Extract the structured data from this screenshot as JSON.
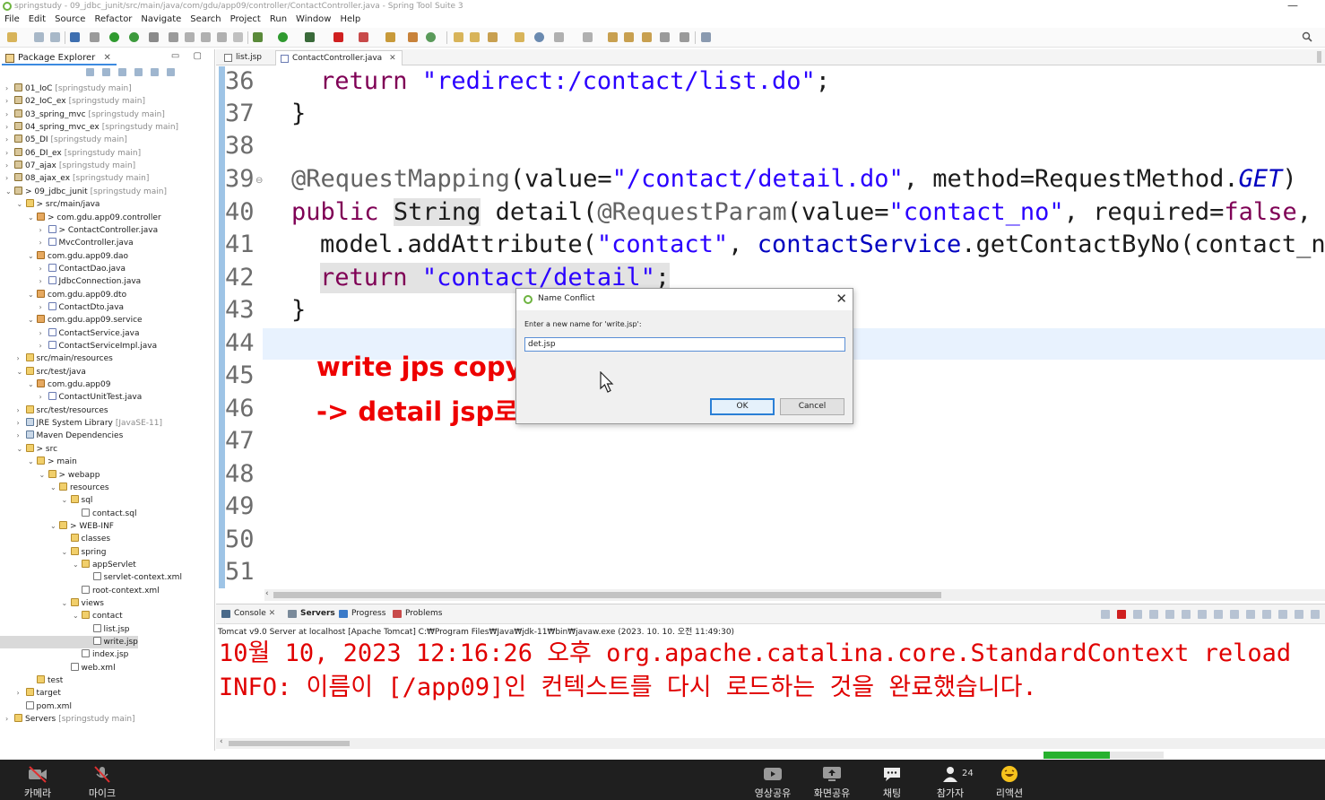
{
  "window": {
    "title": "springstudy - 09_jdbc_junit/src/main/java/com/gdu/app09/controller/ContactController.java - Spring Tool Suite 3"
  },
  "menu": [
    "File",
    "Edit",
    "Source",
    "Refactor",
    "Navigate",
    "Search",
    "Project",
    "Run",
    "Window",
    "Help"
  ],
  "package_explorer": {
    "title": "Package Explorer",
    "rows": [
      {
        "indent": 0,
        "twisty": ">",
        "icon": "proj",
        "label": "01_IoC",
        "suffix": "[springstudy main]"
      },
      {
        "indent": 0,
        "twisty": ">",
        "icon": "proj",
        "label": "02_IoC_ex",
        "suffix": "[springstudy main]"
      },
      {
        "indent": 0,
        "twisty": ">",
        "icon": "proj",
        "label": "03_spring_mvc",
        "suffix": "[springstudy main]"
      },
      {
        "indent": 0,
        "twisty": ">",
        "icon": "proj",
        "label": "04_spring_mvc_ex",
        "suffix": "[springstudy main]"
      },
      {
        "indent": 0,
        "twisty": ">",
        "icon": "proj",
        "label": "05_DI",
        "suffix": "[springstudy main]"
      },
      {
        "indent": 0,
        "twisty": ">",
        "icon": "proj",
        "label": "06_DI_ex",
        "suffix": "[springstudy main]"
      },
      {
        "indent": 0,
        "twisty": ">",
        "icon": "proj",
        "label": "07_ajax",
        "suffix": "[springstudy main]"
      },
      {
        "indent": 0,
        "twisty": ">",
        "icon": "proj",
        "label": "08_ajax_ex",
        "suffix": "[springstudy main]"
      },
      {
        "indent": 0,
        "twisty": "v",
        "icon": "proj",
        "label": "> 09_jdbc_junit",
        "suffix": "[springstudy main]"
      },
      {
        "indent": 1,
        "twisty": "v",
        "icon": "folder",
        "label": "> src/main/java",
        "suffix": ""
      },
      {
        "indent": 2,
        "twisty": "v",
        "icon": "pkgi",
        "label": "> com.gdu.app09.controller",
        "suffix": ""
      },
      {
        "indent": 3,
        "twisty": ">",
        "icon": "java",
        "label": "> ContactController.java",
        "suffix": ""
      },
      {
        "indent": 3,
        "twisty": ">",
        "icon": "java",
        "label": "MvcController.java",
        "suffix": ""
      },
      {
        "indent": 2,
        "twisty": "v",
        "icon": "pkgi",
        "label": "com.gdu.app09.dao",
        "suffix": ""
      },
      {
        "indent": 3,
        "twisty": ">",
        "icon": "java",
        "label": "ContactDao.java",
        "suffix": ""
      },
      {
        "indent": 3,
        "twisty": ">",
        "icon": "java",
        "label": "JdbcConnection.java",
        "suffix": ""
      },
      {
        "indent": 2,
        "twisty": "v",
        "icon": "pkgi",
        "label": "com.gdu.app09.dto",
        "suffix": ""
      },
      {
        "indent": 3,
        "twisty": ">",
        "icon": "java",
        "label": "ContactDto.java",
        "suffix": ""
      },
      {
        "indent": 2,
        "twisty": "v",
        "icon": "pkgi",
        "label": "com.gdu.app09.service",
        "suffix": ""
      },
      {
        "indent": 3,
        "twisty": ">",
        "icon": "java",
        "label": "ContactService.java",
        "suffix": ""
      },
      {
        "indent": 3,
        "twisty": ">",
        "icon": "java",
        "label": "ContactServiceImpl.java",
        "suffix": ""
      },
      {
        "indent": 1,
        "twisty": ">",
        "icon": "folder",
        "label": "src/main/resources",
        "suffix": ""
      },
      {
        "indent": 1,
        "twisty": "v",
        "icon": "folder",
        "label": "src/test/java",
        "suffix": ""
      },
      {
        "indent": 2,
        "twisty": "v",
        "icon": "pkgi",
        "label": "com.gdu.app09",
        "suffix": ""
      },
      {
        "indent": 3,
        "twisty": ">",
        "icon": "java",
        "label": "ContactUnitTest.java",
        "suffix": ""
      },
      {
        "indent": 1,
        "twisty": ">",
        "icon": "folder",
        "label": "src/test/resources",
        "suffix": ""
      },
      {
        "indent": 1,
        "twisty": ">",
        "icon": "lib",
        "label": "JRE System Library",
        "suffix": "[JavaSE-11]"
      },
      {
        "indent": 1,
        "twisty": ">",
        "icon": "lib",
        "label": "Maven Dependencies",
        "suffix": ""
      },
      {
        "indent": 1,
        "twisty": "v",
        "icon": "folder",
        "label": "> src",
        "suffix": ""
      },
      {
        "indent": 2,
        "twisty": "v",
        "icon": "folder",
        "label": "> main",
        "suffix": ""
      },
      {
        "indent": 3,
        "twisty": "v",
        "icon": "folder",
        "label": "> webapp",
        "suffix": ""
      },
      {
        "indent": 4,
        "twisty": "v",
        "icon": "folder",
        "label": "resources",
        "suffix": ""
      },
      {
        "indent": 5,
        "twisty": "v",
        "icon": "folder",
        "label": "sql",
        "suffix": ""
      },
      {
        "indent": 6,
        "twisty": "",
        "icon": "file",
        "label": "contact.sql",
        "suffix": ""
      },
      {
        "indent": 4,
        "twisty": "v",
        "icon": "folder",
        "label": "> WEB-INF",
        "suffix": ""
      },
      {
        "indent": 5,
        "twisty": "",
        "icon": "folder",
        "label": "classes",
        "suffix": ""
      },
      {
        "indent": 5,
        "twisty": "v",
        "icon": "folder",
        "label": "spring",
        "suffix": ""
      },
      {
        "indent": 6,
        "twisty": "v",
        "icon": "folder",
        "label": "appServlet",
        "suffix": ""
      },
      {
        "indent": 7,
        "twisty": "",
        "icon": "file",
        "label": "servlet-context.xml",
        "suffix": ""
      },
      {
        "indent": 6,
        "twisty": "",
        "icon": "file",
        "label": "root-context.xml",
        "suffix": ""
      },
      {
        "indent": 5,
        "twisty": "v",
        "icon": "folder",
        "label": "views",
        "suffix": ""
      },
      {
        "indent": 6,
        "twisty": "v",
        "icon": "folder",
        "label": "contact",
        "suffix": ""
      },
      {
        "indent": 7,
        "twisty": "",
        "icon": "file",
        "label": "list.jsp",
        "suffix": ""
      },
      {
        "indent": 7,
        "twisty": "",
        "icon": "file",
        "label": "write.jsp",
        "suffix": "",
        "selected": true
      },
      {
        "indent": 6,
        "twisty": "",
        "icon": "file",
        "label": "index.jsp",
        "suffix": ""
      },
      {
        "indent": 5,
        "twisty": "",
        "icon": "file",
        "label": "web.xml",
        "suffix": ""
      },
      {
        "indent": 2,
        "twisty": "",
        "icon": "folder",
        "label": "test",
        "suffix": ""
      },
      {
        "indent": 1,
        "twisty": ">",
        "icon": "folder",
        "label": "target",
        "suffix": ""
      },
      {
        "indent": 1,
        "twisty": "",
        "icon": "file",
        "label": "pom.xml",
        "suffix": ""
      },
      {
        "indent": 0,
        "twisty": ">",
        "icon": "folder",
        "label": "Servers",
        "suffix": "[springstudy main]"
      }
    ]
  },
  "editor": {
    "tabs": [
      {
        "label": "list.jsp",
        "active": false
      },
      {
        "label": "ContactController.java",
        "active": true
      }
    ],
    "line_numbers": [
      "36",
      "37",
      "38",
      "39",
      "40",
      "41",
      "42",
      "43",
      "44",
      "45",
      "46",
      "47",
      "48",
      "49",
      "50",
      "51"
    ],
    "code": {
      "l36_kw": "return",
      "l36_str": "\"redirect:/contact/list.do\"",
      "l36_end": ";",
      "l37": "}",
      "l39_ann": "@RequestMapping",
      "l39_a": "(value=",
      "l39_str": "\"/contact/detail.do\"",
      "l39_b": ", method=RequestMethod.",
      "l39_get": "GET",
      "l39_c": ")",
      "l40_kw": "public",
      "l40_type": "String",
      "l40_a": " detail(",
      "l40_ann": "@RequestParam",
      "l40_b": "(value=",
      "l40_str": "\"contact_no\"",
      "l40_c": ", required=",
      "l40_kw2": "false",
      "l40_d": ", de",
      "l41_a": "model.addAttribute(",
      "l41_str": "\"contact\"",
      "l41_b": ", ",
      "l41_fld": "contactService",
      "l41_c": ".getContactByNo(contact_no)",
      "l42_kw": "return",
      "l42_str": "\"contact/detail\"",
      "l42_end": ";",
      "l43": "}"
    },
    "notes": [
      "write jps copy",
      "-> detail jsp로 수정하기 !"
    ]
  },
  "console": {
    "tabs": [
      "Console",
      "Servers",
      "Progress",
      "Problems"
    ],
    "description": "Tomcat v9.0 Server at localhost [Apache Tomcat] C:₩Program Files₩Java₩jdk-11₩bin₩javaw.exe  (2023. 10. 10. 오전 11:49:30)",
    "lines": [
      "10월 10, 2023 12:16:26 오후 org.apache.catalina.core.StandardContext reload",
      "INFO: 이름이 [/app09]인 컨텍스트를 다시 로드하는 것을 완료했습니다."
    ],
    "progress": 0.55
  },
  "dialog": {
    "title": "Name Conflict",
    "prompt": "Enter a new name for 'write.jsp':",
    "value": "det.jsp",
    "ok": "OK",
    "cancel": "Cancel"
  },
  "meeting_bar": {
    "items": [
      "카메라",
      "마이크",
      "영상공유",
      "화면공유",
      "채팅",
      "참가자",
      "리액션"
    ],
    "participant_count": "24"
  },
  "colors": {
    "keyword": "#7f0055",
    "string": "#2a00ff",
    "annotation_note": "#ee0000",
    "console_text": "#e00000"
  }
}
